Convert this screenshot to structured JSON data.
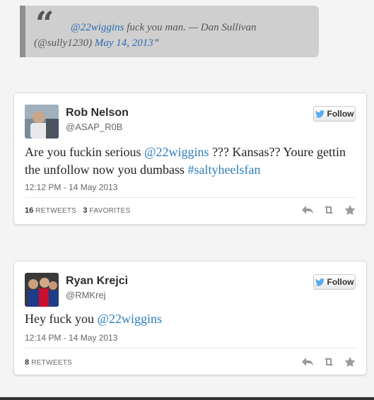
{
  "quote": {
    "mention": "@22wiggins",
    "text": " fuck you man. — Dan Sullivan (@sully1230) ",
    "date": "May 14, 2013",
    "close_mark": "”"
  },
  "tweets": [
    {
      "name": "Rob Nelson",
      "handle": "@ASAP_R0B",
      "follow_label": "Follow",
      "text_parts": [
        "Are you fuckin serious ",
        "@22wiggins",
        " ??? Kansas?? Youre gettin the unfollow now you dumbass ",
        "#saltyheelsfan"
      ],
      "timestamp": "12:12 PM - 14 May 2013",
      "retweets": "16",
      "retweets_label": "Retweets",
      "favorites": "3",
      "favorites_label": "Favorites"
    },
    {
      "name": "Ryan Krejci",
      "handle": "@RMKrej",
      "follow_label": "Follow",
      "text_parts": [
        "Hey fuck you ",
        "@22wiggins"
      ],
      "timestamp": "12:14 PM - 14 May 2013",
      "retweets": "8",
      "retweets_label": "Retweets"
    }
  ],
  "colors": {
    "link": "#2b7bb9",
    "bird": "#55acee",
    "action_icon": "#9a9a9a"
  },
  "icons": [
    "quote-mark-icon",
    "twitter-bird-icon",
    "reply-icon",
    "retweet-icon",
    "favorite-icon"
  ]
}
